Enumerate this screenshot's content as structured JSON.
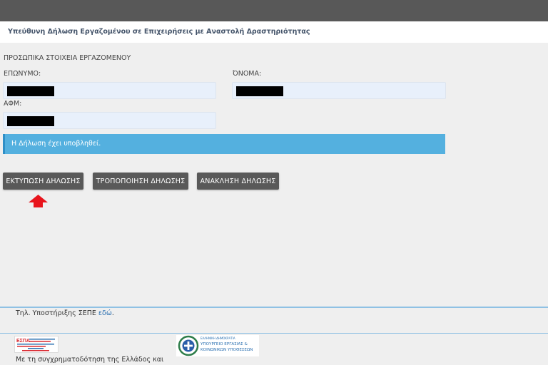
{
  "header": {
    "title": "Υπεύθυνη Δήλωση Εργαζομένου σε Επιχειρήσεις με Αναστολή Δραστηριότητας"
  },
  "form": {
    "section_title": "ΠΡΟΣΩΠΙΚΑ ΣΤΟΙΧΕΙΑ ΕΡΓΑΖΟΜΕΝΟΥ",
    "surname_label": "ΕΠΩΝΥΜΟ:",
    "name_label": "ΌΝΟΜΑ:",
    "afm_label": "ΑΦΜ:"
  },
  "alert": {
    "message": "Η Δήλωση έχει υποβληθεί."
  },
  "actions": {
    "print_label": "ΕΚΤΥΠΩΣΗ ΔΗΛΩΣΗΣ",
    "modify_label": "ΤΡΟΠΟΠΟΙΗΣΗ ΔΗΛΩΣΗΣ",
    "revoke_label": "ΑΝΑΚΛΗΣΗ ΔΗΛΩΣΗΣ"
  },
  "footer": {
    "support_text": "Τηλ. Υποστήριξης ΣΕΠΕ ",
    "support_link": "εδώ",
    "support_period": ".",
    "ministry_small": "ΕΛΛΗΝΙΚΗ ΔΗΜΟΚΡΑΤΙΑ",
    "ministry_line1": "ΥΠΟΥΡΓΕΙΟ ΕΡΓΑΣΙΑΣ &",
    "ministry_line2": "ΚΟΙΝΩΝΙΚΩΝ ΥΠΟΘΕΣΕΩΝ",
    "cofund_text": "Με τη συγχρηματοδότηση της Ελλάδος και",
    "espa_logo_text": "ΕΣΠΑ"
  },
  "colors": {
    "topbar": "#585858",
    "alert_bg": "#54b0df",
    "button_bg": "#595959",
    "arrow": "#e8141c",
    "link": "#2a6fb0"
  },
  "icons": {
    "indicator": "up-arrow-icon",
    "ministry": "greek-emblem-icon"
  }
}
